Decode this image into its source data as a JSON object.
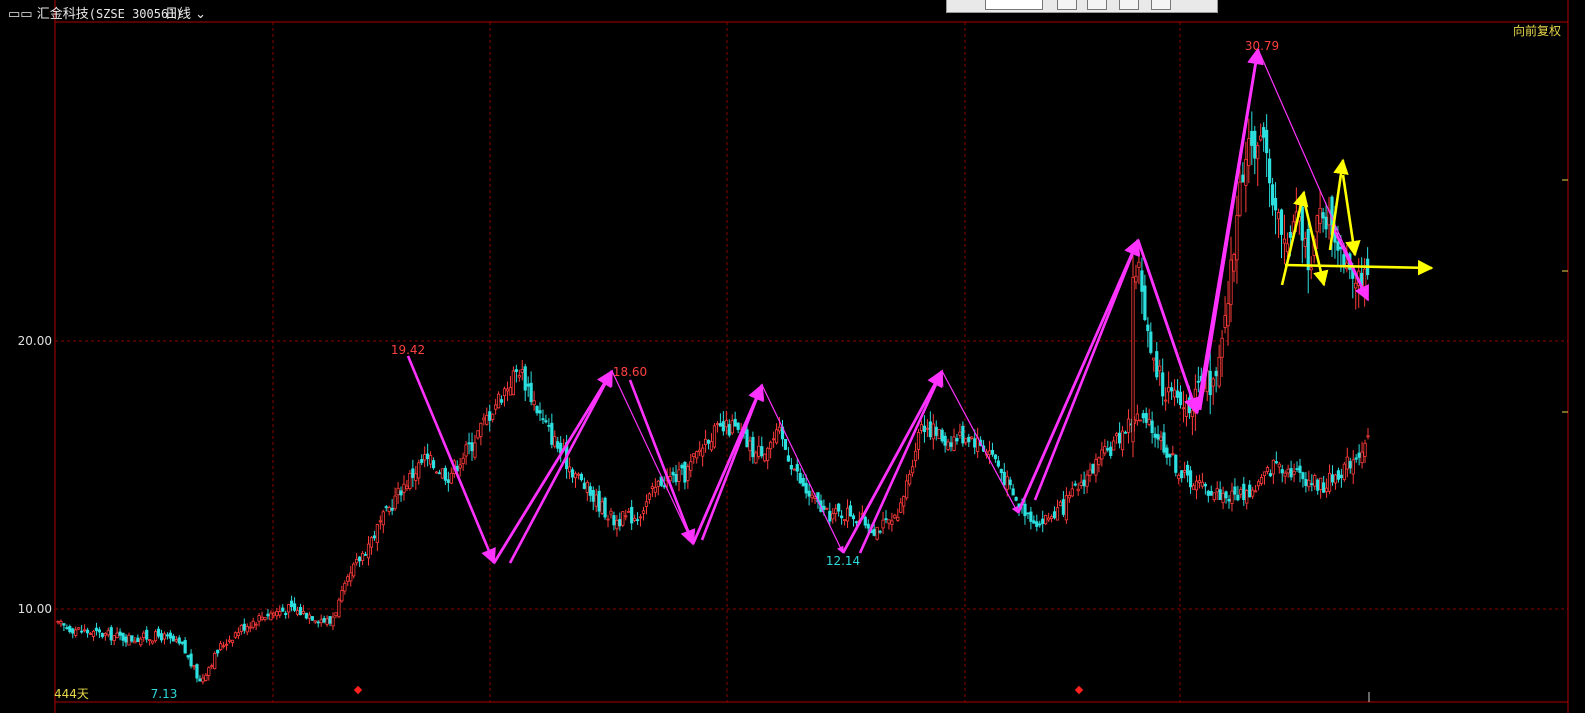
{
  "header": {
    "icon": "window-icon",
    "stock_name": "汇金科技",
    "stock_code": "(SZSE 300561)",
    "period": "日线"
  },
  "adjustment": "向前复权",
  "days_label": "444天",
  "colors": {
    "up": "#ff3b3b",
    "down": "#2ce0e0",
    "grid": "#8a0000",
    "zigzag": "#ff33ff",
    "pattern": "#ffff00",
    "price_label_high": "#ff4040",
    "price_label_low": "#30d8d8",
    "axis_text": "#e0e0e0"
  },
  "chart_data": {
    "type": "candlestick",
    "y_ticks": [
      {
        "value": 20.0,
        "label": "20.00"
      },
      {
        "value": 10.0,
        "label": "10.00"
      }
    ],
    "ylim": [
      7.3,
      32.2
    ],
    "x_count": 444,
    "anchors": [
      [
        0,
        9.4
      ],
      [
        12,
        9.1
      ],
      [
        25,
        8.9
      ],
      [
        35,
        9.0
      ],
      [
        42,
        8.6
      ],
      [
        48,
        7.3
      ],
      [
        55,
        8.6
      ],
      [
        62,
        9.3
      ],
      [
        70,
        9.8
      ],
      [
        78,
        10.0
      ],
      [
        85,
        9.8
      ],
      [
        92,
        9.5
      ],
      [
        100,
        11.5
      ],
      [
        108,
        13.0
      ],
      [
        116,
        14.5
      ],
      [
        124,
        15.6
      ],
      [
        132,
        15.0
      ],
      [
        140,
        16.2
      ],
      [
        148,
        17.7
      ],
      [
        156,
        19.0
      ],
      [
        164,
        17.0
      ],
      [
        172,
        15.5
      ],
      [
        180,
        14.3
      ],
      [
        188,
        13.3
      ],
      [
        196,
        13.5
      ],
      [
        204,
        14.8
      ],
      [
        212,
        15.0
      ],
      [
        220,
        16.5
      ],
      [
        228,
        16.8
      ],
      [
        236,
        15.8
      ],
      [
        244,
        16.5
      ],
      [
        252,
        14.5
      ],
      [
        260,
        13.5
      ],
      [
        268,
        13.6
      ],
      [
        276,
        13.0
      ],
      [
        284,
        13.3
      ],
      [
        292,
        17.0
      ],
      [
        300,
        16.3
      ],
      [
        308,
        16.5
      ],
      [
        316,
        15.8
      ],
      [
        324,
        14.0
      ],
      [
        332,
        13.2
      ],
      [
        340,
        13.8
      ],
      [
        348,
        15.0
      ],
      [
        356,
        16.0
      ],
      [
        364,
        17.2
      ],
      [
        372,
        16.5
      ],
      [
        380,
        15.0
      ],
      [
        388,
        14.5
      ],
      [
        396,
        14.2
      ],
      [
        404,
        14.4
      ],
      [
        412,
        15.5
      ],
      [
        420,
        15.0
      ],
      [
        428,
        14.6
      ],
      [
        436,
        15.4
      ],
      [
        444,
        16.4
      ]
    ],
    "zigzag_main": [
      [
        348,
        19.42
      ],
      [
        443,
        11.7
      ],
      [
        555,
        18.6
      ],
      [
        640,
        12.5
      ],
      [
        705,
        18.2
      ],
      [
        785,
        12.14
      ],
      [
        890,
        18.6
      ],
      [
        968,
        13.7
      ],
      [
        1090,
        23.3
      ],
      [
        1150,
        17.4
      ],
      [
        1205,
        31.1
      ],
      [
        1319,
        21.7
      ]
    ],
    "pattern_yellow": [
      [
        1236,
        22.0
      ],
      [
        1256,
        25.1
      ],
      [
        1275,
        22.0
      ],
      [
        1295,
        26.2
      ],
      [
        1306,
        22.6
      ],
      [
        1386,
        22.5
      ]
    ],
    "annotations": [
      {
        "label": "19.42",
        "x": 356,
        "value": 19.42,
        "kind": "high"
      },
      {
        "label": "18.60",
        "x": 580,
        "value": 18.6,
        "kind": "high"
      },
      {
        "label": "12.14",
        "x": 793,
        "value": 12.14,
        "kind": "low"
      },
      {
        "label": "30.79",
        "x": 1210,
        "value": 30.79,
        "kind": "high"
      },
      {
        "label": "7.13",
        "x": 115,
        "value": 7.13,
        "kind": "low"
      }
    ]
  }
}
